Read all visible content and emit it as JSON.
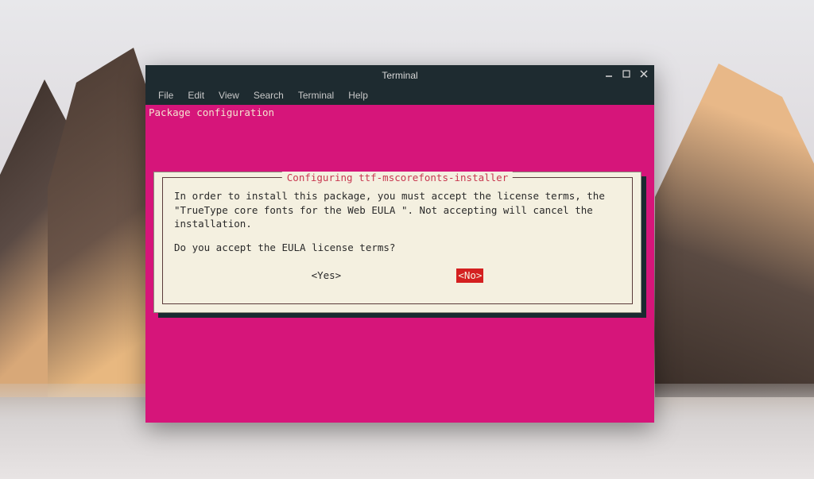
{
  "window": {
    "title": "Terminal"
  },
  "menubar": {
    "items": [
      "File",
      "Edit",
      "View",
      "Search",
      "Terminal",
      "Help"
    ]
  },
  "terminal": {
    "header_label": "Package configuration"
  },
  "dialog": {
    "title": " Configuring ttf-mscorefonts-installer ",
    "body_text": "In order to install this package, you must accept the license terms, the \"TrueType core fonts for the Web EULA \". Not accepting will cancel the installation.",
    "question": "Do you accept the EULA license terms?",
    "yes_label": "<Yes>",
    "no_label": "<No>",
    "selected": "no"
  },
  "colors": {
    "terminal_bg": "#d6157a",
    "dialog_bg": "#f4f0e0",
    "titlebar_bg": "#1e2b30",
    "highlight": "#d42020",
    "title_fg": "#c83850"
  }
}
